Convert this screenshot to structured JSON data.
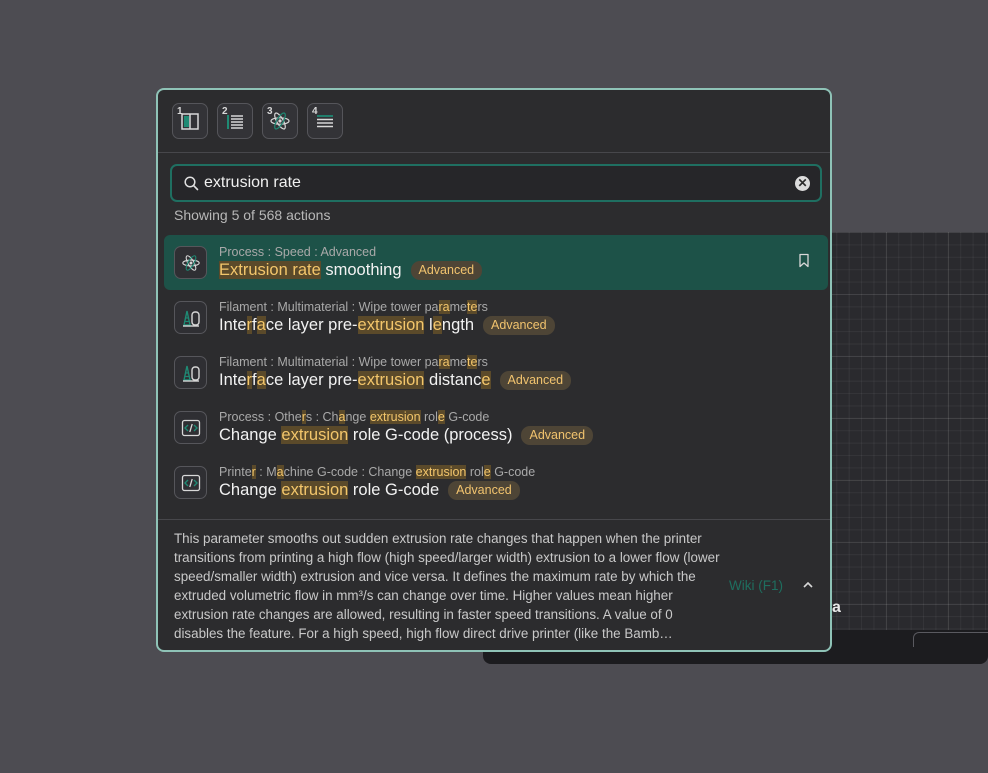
{
  "toolbar": {
    "buttons": [
      {
        "number": "1",
        "icon": "printer-settings-icon"
      },
      {
        "number": "2",
        "icon": "filament-settings-icon"
      },
      {
        "number": "3",
        "icon": "process-settings-icon"
      },
      {
        "number": "4",
        "icon": "layers-icon"
      }
    ]
  },
  "search": {
    "value": "extrusion rate",
    "placeholder": "",
    "clear_symbol": "✕"
  },
  "results_count": "Showing 5 of 568 actions",
  "results": [
    {
      "path_parts": [
        {
          "t": "Process : Speed : Advanced"
        }
      ],
      "title_parts": [
        {
          "t": "Extrusion rate",
          "h": true
        },
        {
          "t": " smoothing"
        }
      ],
      "badge": "Advanced",
      "icon": "process-settings-icon",
      "selected": true
    },
    {
      "path_parts": [
        {
          "t": "Filament : Multimaterial : Wipe tower pa"
        },
        {
          "t": "ra",
          "h": true
        },
        {
          "t": "me"
        },
        {
          "t": "te",
          "h": true
        },
        {
          "t": "rs"
        }
      ],
      "title_parts": [
        {
          "t": "Inte"
        },
        {
          "t": "r",
          "h": true
        },
        {
          "t": "f"
        },
        {
          "t": "a",
          "h": true
        },
        {
          "t": "ce layer pre-"
        },
        {
          "t": "extrusion",
          "h": true
        },
        {
          "t": " l"
        },
        {
          "t": "e",
          "h": true
        },
        {
          "t": "ngth"
        }
      ],
      "badge": "Advanced",
      "icon": "filament-settings-icon",
      "selected": false
    },
    {
      "path_parts": [
        {
          "t": "Filament : Multimaterial : Wipe tower pa"
        },
        {
          "t": "ra",
          "h": true
        },
        {
          "t": "me"
        },
        {
          "t": "te",
          "h": true
        },
        {
          "t": "rs"
        }
      ],
      "title_parts": [
        {
          "t": "Inte"
        },
        {
          "t": "r",
          "h": true
        },
        {
          "t": "f"
        },
        {
          "t": "a",
          "h": true
        },
        {
          "t": "ce layer pre-"
        },
        {
          "t": "extrusion",
          "h": true
        },
        {
          "t": " distanc"
        },
        {
          "t": "e",
          "h": true
        }
      ],
      "badge": "Advanced",
      "icon": "filament-settings-icon",
      "selected": false
    },
    {
      "path_parts": [
        {
          "t": "Process : Othe"
        },
        {
          "t": "r",
          "h": true
        },
        {
          "t": "s : Ch"
        },
        {
          "t": "a",
          "h": true
        },
        {
          "t": "nge "
        },
        {
          "t": "extrusion",
          "h": true
        },
        {
          "t": " rol"
        },
        {
          "t": "e",
          "h": true
        },
        {
          "t": " G-code"
        }
      ],
      "title_parts": [
        {
          "t": "Change "
        },
        {
          "t": "extrusion",
          "h": true
        },
        {
          "t": " role G-code (process)"
        }
      ],
      "badge": "Advanced",
      "icon": "code-icon",
      "selected": false
    },
    {
      "path_parts": [
        {
          "t": "Printe"
        },
        {
          "t": "r",
          "h": true
        },
        {
          "t": " : M"
        },
        {
          "t": "a",
          "h": true
        },
        {
          "t": "chine G-code : Change "
        },
        {
          "t": "extrusion",
          "h": true
        },
        {
          "t": " rol"
        },
        {
          "t": "e",
          "h": true
        },
        {
          "t": " G-code"
        }
      ],
      "title_parts": [
        {
          "t": "Change "
        },
        {
          "t": "extrusion",
          "h": true
        },
        {
          "t": " role G-code"
        }
      ],
      "badge": "Advanced",
      "icon": "code-icon",
      "selected": false
    }
  ],
  "description": "This parameter smooths out sudden extrusion rate changes that happen when the printer transitions from printing a high flow (high speed/larger width) extrusion to a lower flow (lower speed/smaller width) extrusion and vice versa. It defines the maximum rate by which the extruded volumetric flow in mm³/s can change over time. Higher values mean higher extrusion rate changes are allowed, resulting in faster speed transitions. A value of 0 disables the feature. For a high speed, high flow direct drive printer (like the Bamb…",
  "wiki_link": "Wiki (F1)",
  "background": {
    "plate_letter": "a"
  },
  "colors": {
    "accent": "#8fc3b7",
    "selected_row": "#1d5248",
    "highlight_text": "#f3c66b",
    "badge_text": "#f1c36e",
    "wiki_link": "#1e6e5f"
  }
}
